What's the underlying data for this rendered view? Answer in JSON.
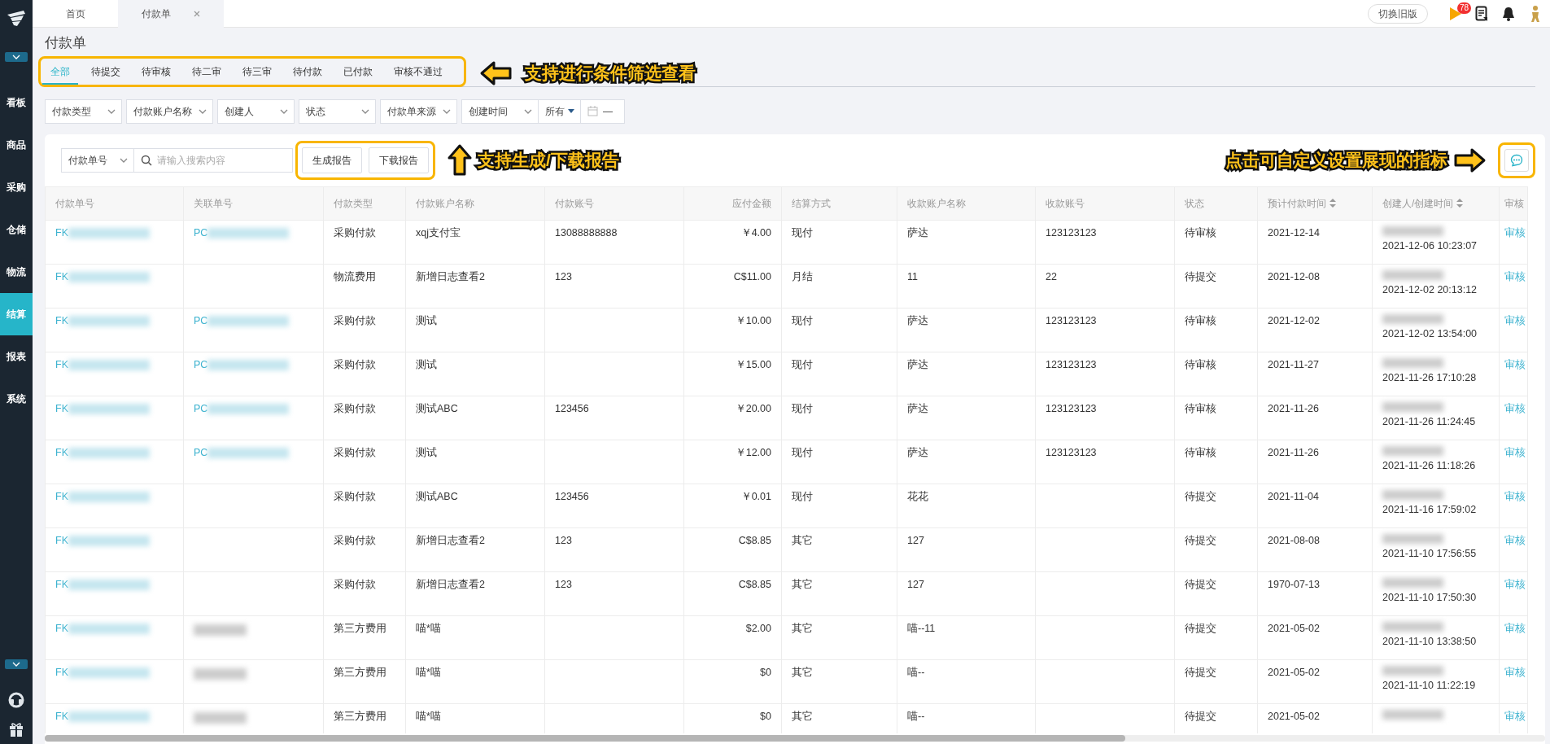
{
  "sidebar": {
    "items": [
      {
        "label": "看板",
        "selected": false
      },
      {
        "label": "商品",
        "selected": false
      },
      {
        "label": "采购",
        "selected": false
      },
      {
        "label": "仓储",
        "selected": false
      },
      {
        "label": "物流",
        "selected": false
      },
      {
        "label": "结算",
        "selected": true
      },
      {
        "label": "报表",
        "selected": false
      },
      {
        "label": "系统",
        "selected": false
      }
    ]
  },
  "top_tabs": [
    {
      "label": "首页",
      "selected": false,
      "closable": false
    },
    {
      "label": "付款单",
      "selected": true,
      "closable": true
    }
  ],
  "header": {
    "switch_button": "切换旧版",
    "notification_count": "78"
  },
  "page_title": "付款单",
  "status_tabs": [
    {
      "label": "全部",
      "selected": true
    },
    {
      "label": "待提交",
      "selected": false
    },
    {
      "label": "待审核",
      "selected": false
    },
    {
      "label": "待二审",
      "selected": false
    },
    {
      "label": "待三审",
      "selected": false
    },
    {
      "label": "待付款",
      "selected": false
    },
    {
      "label": "已付款",
      "selected": false
    },
    {
      "label": "审核不通过",
      "selected": false
    }
  ],
  "filters": [
    {
      "label": "付款类型",
      "kind": "select"
    },
    {
      "label": "付款账户名称",
      "kind": "select"
    },
    {
      "label": "创建人",
      "kind": "select"
    },
    {
      "label": "状态",
      "kind": "select"
    },
    {
      "label": "付款单来源",
      "kind": "select"
    },
    {
      "label": "创建时间",
      "kind": "select"
    },
    {
      "label": "所有",
      "kind": "dropdown"
    },
    {
      "label": "—",
      "kind": "date"
    }
  ],
  "toolbar": {
    "field_select": "付款单号",
    "search_placeholder": "请输入搜索内容",
    "buttons": [
      "生成报告",
      "下载报告"
    ]
  },
  "annotations": {
    "filter_tabs": "支持进行条件筛选查看",
    "report_buttons": "支持生成/下载报告",
    "column_settings": "点击可自定义设置展现的指标"
  },
  "table": {
    "columns": [
      {
        "label": "付款单号",
        "sortable": false
      },
      {
        "label": "关联单号",
        "sortable": false
      },
      {
        "label": "付款类型",
        "sortable": false
      },
      {
        "label": "付款账户名称",
        "sortable": false
      },
      {
        "label": "付款账号",
        "sortable": false
      },
      {
        "label": "应付金额",
        "sortable": false
      },
      {
        "label": "结算方式",
        "sortable": false
      },
      {
        "label": "收款账户名称",
        "sortable": false
      },
      {
        "label": "收款账号",
        "sortable": false
      },
      {
        "label": "状态",
        "sortable": false
      },
      {
        "label": "预计付款时间",
        "sortable": true
      },
      {
        "label": "创建人/创建时间",
        "sortable": true
      },
      {
        "label": "审核",
        "sortable": false
      }
    ],
    "rows": [
      {
        "order_no": "FK",
        "related_no": "PC",
        "type": "采购付款",
        "account_name": "xqj支付宝",
        "account_no": "13088888888",
        "amount": "￥4.00",
        "settlement": "现付",
        "payee_name": "萨达",
        "payee_account": "123123123",
        "status": "待审核",
        "expected_date": "2021-12-14",
        "created_at": "2021-12-06 10:23:07",
        "action": "审核"
      },
      {
        "order_no": "FK",
        "type": "物流费用",
        "account_name": "新增日志查看2",
        "account_no": "123",
        "amount": "C$11.00",
        "settlement": "月结",
        "payee_name": "11",
        "payee_account": "22",
        "status": "待提交",
        "expected_date": "2021-12-08",
        "created_at": "2021-12-02 20:13:12",
        "action": "审核"
      },
      {
        "order_no": "FK",
        "related_no": "PC",
        "type": "采购付款",
        "account_name": "测试",
        "amount": "￥10.00",
        "settlement": "现付",
        "payee_name": "萨达",
        "payee_account": "123123123",
        "status": "待审核",
        "expected_date": "2021-12-02",
        "created_at": "2021-12-02 13:54:00",
        "action": "审核"
      },
      {
        "order_no": "FK",
        "related_no": "PC",
        "type": "采购付款",
        "account_name": "测试",
        "amount": "￥15.00",
        "settlement": "现付",
        "payee_name": "萨达",
        "payee_account": "123123123",
        "status": "待审核",
        "expected_date": "2021-11-27",
        "created_at": "2021-11-26 17:10:28",
        "action": "审核"
      },
      {
        "order_no": "FK",
        "related_no": "PC",
        "type": "采购付款",
        "account_name": "测试ABC",
        "account_no": "123456",
        "amount": "￥20.00",
        "settlement": "现付",
        "payee_name": "萨达",
        "payee_account": "123123123",
        "status": "待审核",
        "expected_date": "2021-11-26",
        "created_at": "2021-11-26 11:24:45",
        "action": "审核"
      },
      {
        "order_no": "FK",
        "related_no": "PC",
        "type": "采购付款",
        "account_name": "测试",
        "amount": "￥12.00",
        "settlement": "现付",
        "payee_name": "萨达",
        "payee_account": "123123123",
        "status": "待审核",
        "expected_date": "2021-11-26",
        "created_at": "2021-11-26 11:18:26",
        "action": "审核"
      },
      {
        "order_no": "FK",
        "type": "采购付款",
        "account_name": "测试ABC",
        "account_no": "123456",
        "amount": "￥0.01",
        "settlement": "现付",
        "payee_name": "花花",
        "status": "待提交",
        "expected_date": "2021-11-04",
        "created_at": "2021-11-16 17:59:02",
        "action": "审核"
      },
      {
        "order_no": "FK",
        "type": "采购付款",
        "account_name": "新增日志查看2",
        "account_no": "123",
        "amount": "C$8.85",
        "settlement": "其它",
        "payee_name": "127",
        "status": "待提交",
        "expected_date": "2021-08-08",
        "created_at": "2021-11-10 17:56:55",
        "action": "审核"
      },
      {
        "order_no": "FK",
        "type": "采购付款",
        "account_name": "新增日志查看2",
        "account_no": "123",
        "amount": "C$8.85",
        "settlement": "其它",
        "payee_name": "127",
        "status": "待提交",
        "expected_date": "1970-07-13",
        "created_at": "2021-11-10 17:50:30",
        "action": "审核"
      },
      {
        "order_no": "FK",
        "related_blurred": true,
        "type": "第三方费用",
        "account_name": "喵*喵",
        "amount": "$2.00",
        "settlement": "其它",
        "payee_name": "喵--11",
        "status": "待提交",
        "expected_date": "2021-05-02",
        "created_at": "2021-11-10 13:38:50",
        "action": "审核"
      },
      {
        "order_no": "FK",
        "related_blurred": true,
        "type": "第三方费用",
        "account_name": "喵*喵",
        "amount": "$0",
        "settlement": "其它",
        "payee_name": "喵--",
        "status": "待提交",
        "expected_date": "2021-05-02",
        "created_at": "2021-11-10 11:22:19",
        "action": "审核"
      },
      {
        "order_no": "FK",
        "related_blurred": true,
        "type": "第三方费用",
        "account_name": "喵*喵",
        "amount": "$0",
        "settlement": "其它",
        "payee_name": "喵--",
        "status": "待提交",
        "expected_date": "2021-05-02",
        "action": "审核"
      }
    ]
  }
}
